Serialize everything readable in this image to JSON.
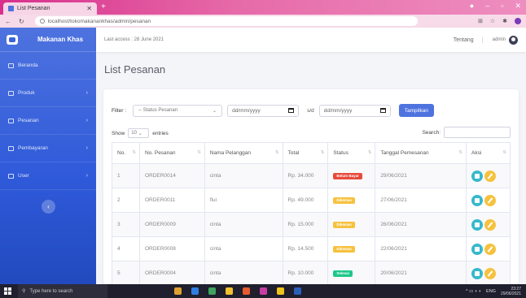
{
  "browser": {
    "tab_title": "List Pesanan",
    "url": "localhost/tokomakanankhas/admin/pesanan"
  },
  "sidebar": {
    "brand": "Makanan Khas",
    "items": [
      {
        "label": "Beranda",
        "has_chevron": false
      },
      {
        "label": "Produk",
        "has_chevron": true
      },
      {
        "label": "Pesanan",
        "has_chevron": true
      },
      {
        "label": "Pembayaran",
        "has_chevron": true
      },
      {
        "label": "User",
        "has_chevron": true
      }
    ]
  },
  "topbar": {
    "last_access": "Last access : 28 June 2021",
    "tentang": "Tentang",
    "user": "admin"
  },
  "page": {
    "title": "List Pesanan"
  },
  "filter": {
    "label": "Filter :",
    "status_placeholder": "-- Status Pesanan",
    "date_placeholder": "dd/mm/yyyy",
    "sd_label": "s/d",
    "button": "Tampilkan"
  },
  "table_controls": {
    "show": "Show",
    "entries_value": "10",
    "entries": "entries",
    "search": "Search:"
  },
  "table": {
    "headers": [
      "No.",
      "No. Pesanan",
      "Nama Pelanggan",
      "Total",
      "Status",
      "Tanggal Pemesanan",
      "Aksi"
    ],
    "rows": [
      {
        "no": "1",
        "order": "ORDER0014",
        "name": "cinta",
        "total": "Rp. 34.000",
        "status": "Belum Bayar",
        "status_color": "#e74a3b",
        "date": "29/06/2021"
      },
      {
        "no": "2",
        "order": "ORDER0011",
        "name": "flui",
        "total": "Rp. 49.000",
        "status": "Dikemas",
        "status_color": "#f6c23e",
        "date": "27/06/2021"
      },
      {
        "no": "3",
        "order": "ORDER0009",
        "name": "cinta",
        "total": "Rp. 15.000",
        "status": "Dikemas",
        "status_color": "#f6c23e",
        "date": "26/06/2021"
      },
      {
        "no": "4",
        "order": "ORDER0008",
        "name": "cinta",
        "total": "Rp. 14.500",
        "status": "Dikemas",
        "status_color": "#f6c23e",
        "date": "22/06/2021"
      },
      {
        "no": "5",
        "order": "ORDER0004",
        "name": "cinta",
        "total": "Rp. 10.000",
        "status": "Selesai",
        "status_color": "#1cc88a",
        "date": "20/06/2021"
      }
    ]
  },
  "taskbar": {
    "search": "Type here to search",
    "lang": "ENG",
    "time": "23:27",
    "date": "29/06/2021"
  }
}
